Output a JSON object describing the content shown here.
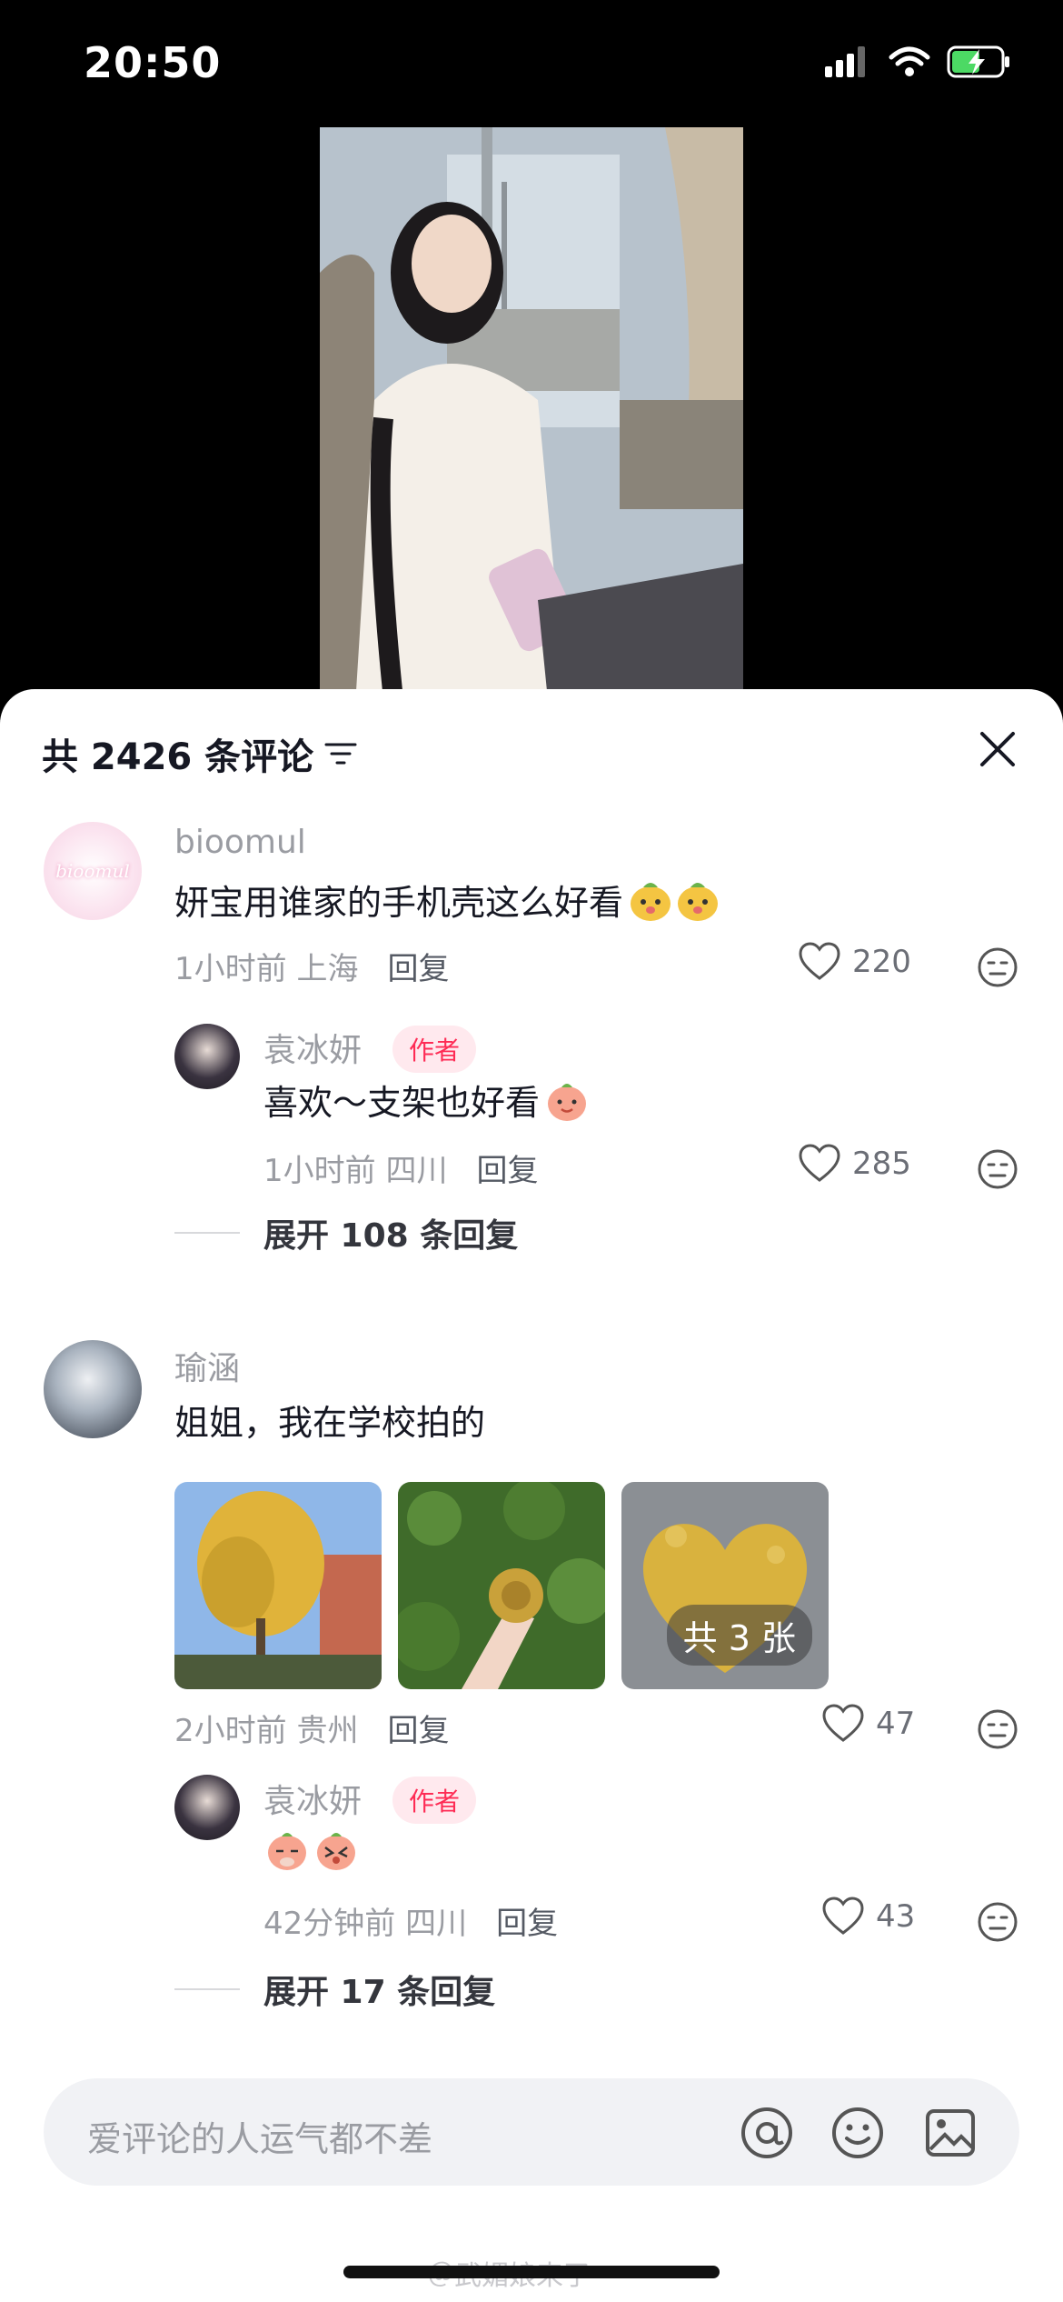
{
  "status": {
    "time": "20:50"
  },
  "sheet": {
    "count_label": "共 2426 条评论"
  },
  "comments": [
    {
      "username": "bioomul",
      "avatar_text": "bioomul",
      "text": "妍宝用谁家的手机壳这么好看",
      "time": "1小时前",
      "location": "上海",
      "reply_label": "回复",
      "likes": "220",
      "replies": [
        {
          "username": "袁冰妍",
          "tag": "作者",
          "text": "喜欢～支架也好看",
          "time": "1小时前",
          "location": "四川",
          "reply_label": "回复",
          "likes": "285"
        }
      ],
      "expand_label": "展开 108 条回复"
    },
    {
      "username": "瑜涵",
      "text": "姐姐，我在学校拍的",
      "photo_count_label": "共 3 张",
      "time": "2小时前",
      "location": "贵州",
      "reply_label": "回复",
      "likes": "47",
      "replies": [
        {
          "username": "袁冰妍",
          "tag": "作者",
          "time": "42分钟前",
          "location": "四川",
          "reply_label": "回复",
          "likes": "43"
        }
      ],
      "expand_label": "展开 17 条回复"
    }
  ],
  "input": {
    "placeholder": "爱评论的人运气都不差"
  },
  "watermark": "＠武媚娘来了",
  "colors": {
    "accent": "#fe2c55",
    "text": "#161823",
    "muted": "#9a9ca2"
  }
}
